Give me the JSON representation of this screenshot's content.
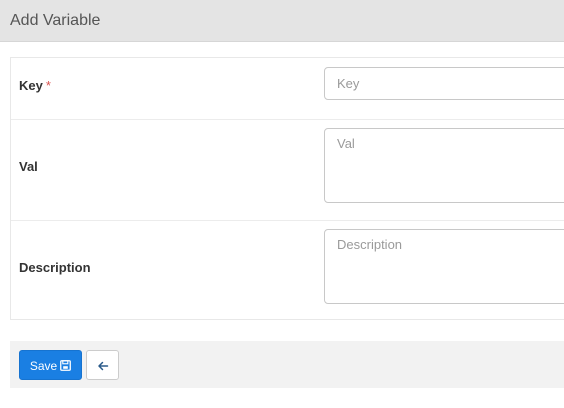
{
  "header": {
    "title": "Add Variable"
  },
  "form": {
    "key": {
      "label": "Key",
      "required_marker": "*",
      "placeholder": "Key",
      "value": ""
    },
    "val": {
      "label": "Val",
      "placeholder": "Val",
      "value": ""
    },
    "description": {
      "label": "Description",
      "placeholder": "Description",
      "value": ""
    }
  },
  "footer": {
    "save_label": "Save",
    "save_icon": "floppy-disk-icon",
    "back_icon": "arrow-left-icon"
  },
  "colors": {
    "header_bg": "#e4e4e4",
    "primary": "#1a7fe3",
    "required": "#d9534f",
    "footer_bg": "#f2f2f2"
  }
}
